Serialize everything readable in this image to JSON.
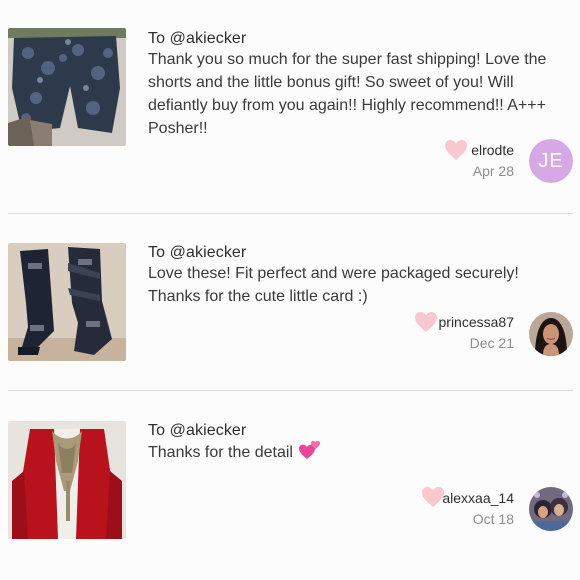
{
  "reviews": [
    {
      "to": "To @akiecker",
      "text": "Thank you so much for the super fast shipping! Love the shorts and the little bonus gift! So sweet of you! Will defiantly buy from you again!! Highly recommend!! A+++ Posher!!",
      "username": "elrodte",
      "date": "Apr 28",
      "avatar_initials": "JE",
      "item_icon": "floral-shorts-photo"
    },
    {
      "to": "To @akiecker",
      "text": "Love these! Fit perfect and were packaged securely! Thanks for the cute little card :)",
      "username": "princessa87",
      "date": "Dec 21",
      "item_icon": "black-boots-photo"
    },
    {
      "to": "To @akiecker",
      "text": "Thanks for the detail",
      "text_emoji": "two-hearts-emoji",
      "username": "alexxaa_14",
      "date": "Oct 18",
      "item_icon": "red-cardigan-photo"
    }
  ],
  "colors": {
    "heart": "#f8c7cf",
    "avatar_bg": "#d6a9e6",
    "divider": "#dcdcdc",
    "date": "#8e8e8e"
  }
}
